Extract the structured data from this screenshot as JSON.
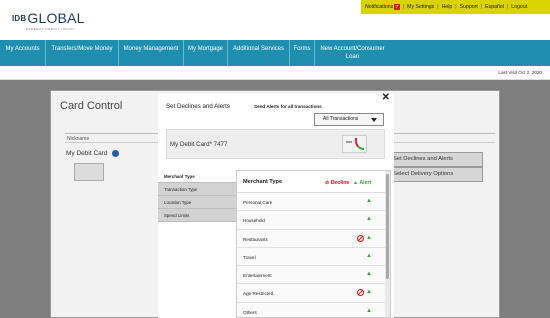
{
  "header": {
    "logo_prefix": "IDB",
    "logo_main": "GLOBAL",
    "logo_tagline": "FEDERAL CREDIT UNION",
    "utility_links": [
      "Notifications",
      "My Settings",
      "Help",
      "Support",
      "Español",
      "Logout"
    ],
    "notifications_count": "7",
    "utility_bar_color": "#d9d300"
  },
  "nav": {
    "background_color": "#1f8fb0",
    "items": [
      {
        "label": "My Accounts"
      },
      {
        "label": "Transfers/Move Money"
      },
      {
        "label": "Money Management"
      },
      {
        "label": "My Mortgage"
      },
      {
        "label": "Additional Services"
      },
      {
        "label": "Forms"
      },
      {
        "label": "New Account/Consumer Loan"
      }
    ]
  },
  "last_visit": "Last Visit Oct 2, 2020",
  "background_page": {
    "title": "Card Control",
    "column_header": "Nickname",
    "card_name": "My Debit Card",
    "buttons": [
      "Set Declines and Alerts",
      "Select Delivery Options"
    ]
  },
  "modal": {
    "title": "Set Declines and Alerts",
    "subtitle": "Send Alerts for all transactions",
    "dropdown_selected": "All Transactions",
    "close_icon": "close-icon",
    "card": {
      "name": "My Debit Card* 7477"
    },
    "side_menu": [
      {
        "label": "Merchant Type",
        "active": true
      },
      {
        "label": "Transaction Type",
        "active": false
      },
      {
        "label": "Location Type",
        "active": false
      },
      {
        "label": "Spend Limits",
        "active": false
      }
    ],
    "content": {
      "header_label": "Merchant Type",
      "decline_label": "Decline",
      "allow_label": "Alert",
      "decline_color": "#dd1111",
      "allow_color": "#33aa33",
      "rows": [
        {
          "label": "Personal Care",
          "decline": false
        },
        {
          "label": "Household",
          "decline": false
        },
        {
          "label": "Restaurants",
          "decline": true
        },
        {
          "label": "Travel",
          "decline": false
        },
        {
          "label": "Entertainment",
          "decline": false
        },
        {
          "label": "Age Restricted",
          "decline": true
        },
        {
          "label": "Others",
          "decline": false
        }
      ]
    }
  }
}
